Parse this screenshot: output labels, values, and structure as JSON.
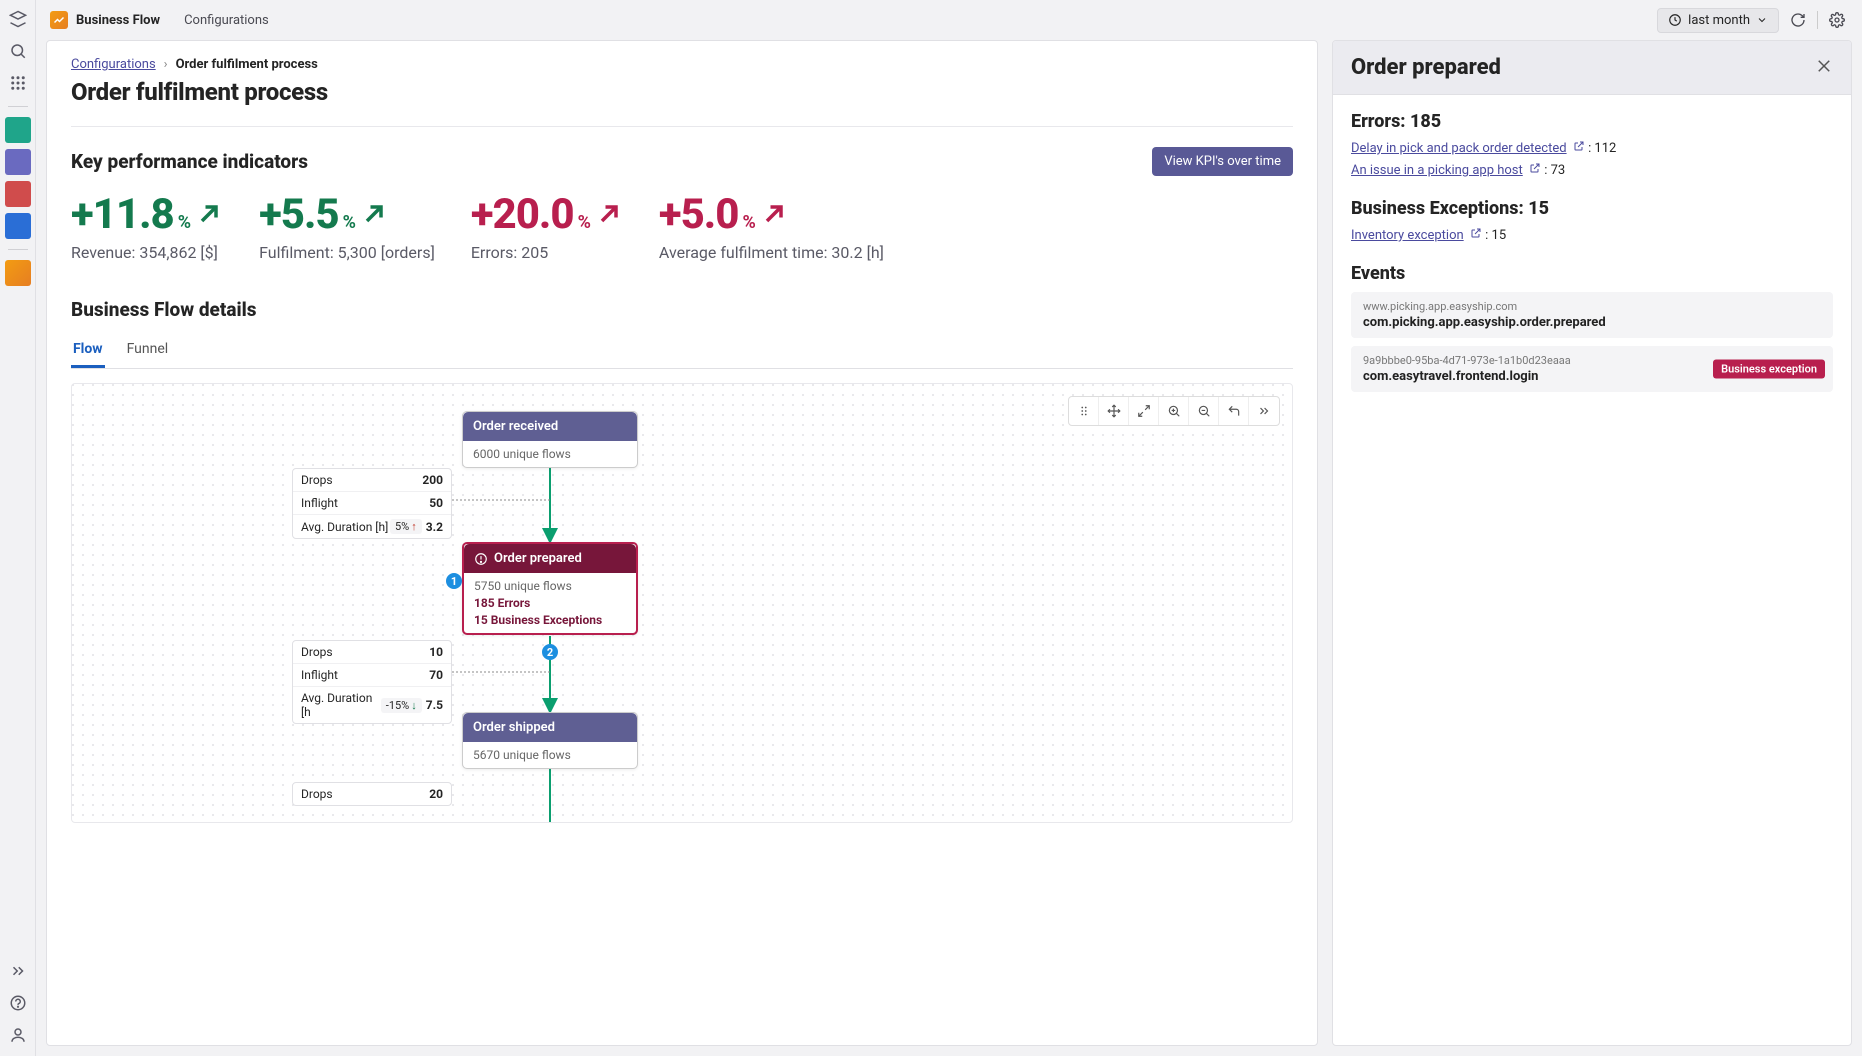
{
  "topbar": {
    "title": "Business Flow",
    "nav_link": "Configurations",
    "time_range": "last month"
  },
  "breadcrumb": {
    "root": "Configurations",
    "current": "Order fulfilment process"
  },
  "page_title": "Order fulfilment process",
  "kpi_section": {
    "heading": "Key performance indicators",
    "button": "View KPI's over time",
    "items": [
      {
        "value": "+11.8",
        "pct": "%",
        "trend": "up",
        "tone": "good",
        "label": "Revenue: 354,862 [$]"
      },
      {
        "value": "+5.5",
        "pct": "%",
        "trend": "up",
        "tone": "good",
        "label": "Fulfilment: 5,300 [orders]"
      },
      {
        "value": "+20.0",
        "pct": "%",
        "trend": "up",
        "tone": "bad",
        "label": "Errors: 205"
      },
      {
        "value": "+5.0",
        "pct": "%",
        "trend": "up",
        "tone": "bad",
        "label": "Average fulfilment time: 30.2 [h]"
      }
    ]
  },
  "flow_section": {
    "heading": "Business Flow details",
    "tabs": [
      "Flow",
      "Funnel"
    ],
    "active_tab": "Flow"
  },
  "flow_nodes": {
    "n1": {
      "title": "Order received",
      "sub": "6000 unique flows"
    },
    "n2": {
      "title": "Order prepared",
      "sub": "5750 unique flows",
      "err1": "185 Errors",
      "err2": "15 Business Exceptions"
    },
    "n3": {
      "title": "Order shipped",
      "sub": "5670 unique flows"
    }
  },
  "metrics1": {
    "drops_l": "Drops",
    "drops_v": "200",
    "inflight_l": "Inflight",
    "inflight_v": "50",
    "dur_l": "Avg. Duration [h]",
    "dur_badge": "5%",
    "dur_dir": "up",
    "dur_v": "3.2"
  },
  "metrics2": {
    "drops_l": "Drops",
    "drops_v": "10",
    "inflight_l": "Inflight",
    "inflight_v": "70",
    "dur_l": "Avg. Duration [h",
    "dur_badge": "-15%",
    "dur_dir": "down",
    "dur_v": "7.5"
  },
  "metrics3": {
    "drops_l": "Drops",
    "drops_v": "20"
  },
  "side_panel": {
    "title": "Order prepared",
    "errors_heading": "Errors: 185",
    "err_links": [
      {
        "text": "Delay in pick and pack order detected",
        "count": ": 112"
      },
      {
        "text": "An issue in a picking app host",
        "count": ": 73"
      }
    ],
    "exceptions_heading": "Business Exceptions: 15",
    "exc_links": [
      {
        "text": "Inventory exception",
        "count": ": 15"
      }
    ],
    "events_heading": "Events",
    "events": [
      {
        "src": "www.picking.app.easyship.com",
        "name": "com.picking.app.easyship.order.prepared",
        "badge": ""
      },
      {
        "src": "9a9bbbe0-95ba-4d71-973e-1a1b0d23eaaa",
        "name": "com.easytravel.frontend.login",
        "badge": "Business exception"
      }
    ]
  }
}
